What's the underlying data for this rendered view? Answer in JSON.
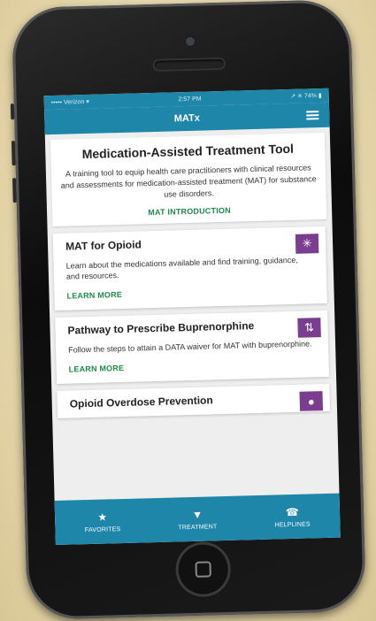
{
  "statusbar": {
    "carrier": "••••• Verizon ▾",
    "time": "2:57 PM",
    "battery": "↗ ✳ 74% ▮"
  },
  "appbar": {
    "title": "MATx"
  },
  "intro": {
    "title": "Medication-Assisted Treatment Tool",
    "description": "A training tool to equip health care practitioners with clinical resources and assessments for medication-assisted treatment (MAT) for substance use disorders.",
    "link": "MAT INTRODUCTION"
  },
  "cards": [
    {
      "title": "MAT for Opioid",
      "description": "Learn about the medications available and find training, guidance, and resources.",
      "link": "LEARN MORE",
      "icon": "snowflake-icon",
      "glyph": "✳"
    },
    {
      "title": "Pathway to Prescribe Buprenorphine",
      "description": "Follow the steps to attain a DATA waiver for MAT with buprenorphine.",
      "link": "LEARN MORE",
      "icon": "pathway-icon",
      "glyph": "⇅"
    },
    {
      "title": "Opioid Overdose Prevention",
      "icon": "pill-icon",
      "glyph": "●"
    }
  ],
  "tabs": [
    {
      "label": "FAVORITES",
      "icon": "star-icon",
      "glyph": "★"
    },
    {
      "label": "TREATMENT",
      "icon": "location-pin-icon",
      "glyph": "▼"
    },
    {
      "label": "HELPLINES",
      "icon": "phone-icon",
      "glyph": "☎"
    }
  ],
  "colors": {
    "primary": "#1e86a8",
    "accent_link": "#1b8a4a",
    "badge": "#7b3d8f",
    "background": "#e6d7ac"
  }
}
